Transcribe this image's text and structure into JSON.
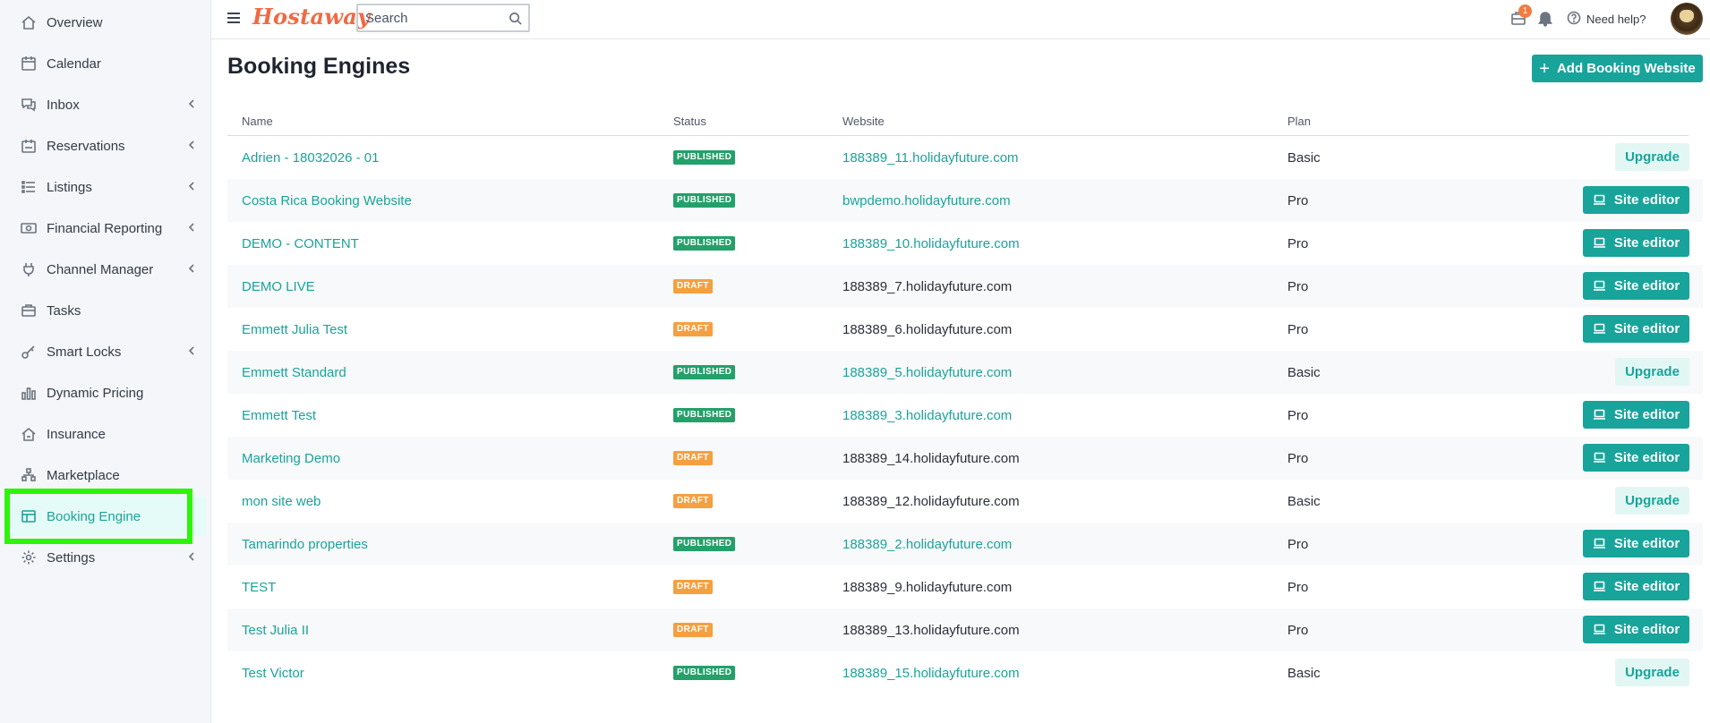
{
  "sidebar": {
    "items": [
      {
        "label": "Overview",
        "icon": "home-icon",
        "chevron": false
      },
      {
        "label": "Calendar",
        "icon": "calendar-icon",
        "chevron": false
      },
      {
        "label": "Inbox",
        "icon": "chat-icon",
        "chevron": true
      },
      {
        "label": "Reservations",
        "icon": "reservations-icon",
        "chevron": true
      },
      {
        "label": "Listings",
        "icon": "list-icon",
        "chevron": true
      },
      {
        "label": "Financial Reporting",
        "icon": "money-icon",
        "chevron": true
      },
      {
        "label": "Channel Manager",
        "icon": "plug-icon",
        "chevron": true
      },
      {
        "label": "Tasks",
        "icon": "briefcase-icon",
        "chevron": false
      },
      {
        "label": "Smart Locks",
        "icon": "key-icon",
        "chevron": true
      },
      {
        "label": "Dynamic Pricing",
        "icon": "bar-chart-icon",
        "chevron": false
      },
      {
        "label": "Insurance",
        "icon": "house-shield-icon",
        "chevron": false
      },
      {
        "label": "Marketplace",
        "icon": "marketplace-icon",
        "chevron": false
      },
      {
        "label": "Booking Engine",
        "icon": "layout-icon",
        "chevron": false,
        "active": true
      },
      {
        "label": "Settings",
        "icon": "gear-icon",
        "chevron": true
      }
    ]
  },
  "topbar": {
    "logo": "Hostaway",
    "search_placeholder": "Search",
    "notification_count": "1",
    "help_label": "Need help?"
  },
  "main": {
    "title": "Booking Engines",
    "add_button_label": "Add Booking Website",
    "columns": [
      "Name",
      "Status",
      "Website",
      "Plan"
    ],
    "rows": [
      {
        "name": "Adrien - 18032026 - 01",
        "status": "PUBLISHED",
        "website": "188389_11.holidayfuture.com",
        "plan": "Basic",
        "action": "Upgrade"
      },
      {
        "name": "Costa Rica Booking Website",
        "status": "PUBLISHED",
        "website": "bwpdemo.holidayfuture.com",
        "plan": "Pro",
        "action": "Site editor"
      },
      {
        "name": "DEMO - CONTENT",
        "status": "PUBLISHED",
        "website": "188389_10.holidayfuture.com",
        "plan": "Pro",
        "action": "Site editor"
      },
      {
        "name": "DEMO LIVE",
        "status": "DRAFT",
        "website": "188389_7.holidayfuture.com",
        "plan": "Pro",
        "action": "Site editor"
      },
      {
        "name": "Emmett Julia Test",
        "status": "DRAFT",
        "website": "188389_6.holidayfuture.com",
        "plan": "Pro",
        "action": "Site editor"
      },
      {
        "name": "Emmett Standard",
        "status": "PUBLISHED",
        "website": "188389_5.holidayfuture.com",
        "plan": "Basic",
        "action": "Upgrade"
      },
      {
        "name": "Emmett Test",
        "status": "PUBLISHED",
        "website": "188389_3.holidayfuture.com",
        "plan": "Pro",
        "action": "Site editor"
      },
      {
        "name": "Marketing Demo",
        "status": "DRAFT",
        "website": "188389_14.holidayfuture.com",
        "plan": "Pro",
        "action": "Site editor"
      },
      {
        "name": "mon site web",
        "status": "DRAFT",
        "website": "188389_12.holidayfuture.com",
        "plan": "Basic",
        "action": "Upgrade"
      },
      {
        "name": "Tamarindo properties",
        "status": "PUBLISHED",
        "website": "188389_2.holidayfuture.com",
        "plan": "Pro",
        "action": "Site editor"
      },
      {
        "name": "TEST",
        "status": "DRAFT",
        "website": "188389_9.holidayfuture.com",
        "plan": "Pro",
        "action": "Site editor"
      },
      {
        "name": "Test Julia II",
        "status": "DRAFT",
        "website": "188389_13.holidayfuture.com",
        "plan": "Pro",
        "action": "Site editor"
      },
      {
        "name": "Test Victor",
        "status": "PUBLISHED",
        "website": "188389_15.holidayfuture.com",
        "plan": "Basic",
        "action": "Upgrade"
      }
    ]
  },
  "colors": {
    "accent": "#18a49b",
    "brand": "#ef6a44",
    "published": "#24a06a",
    "draft": "#f5a040",
    "highlight": "#2cf508"
  }
}
